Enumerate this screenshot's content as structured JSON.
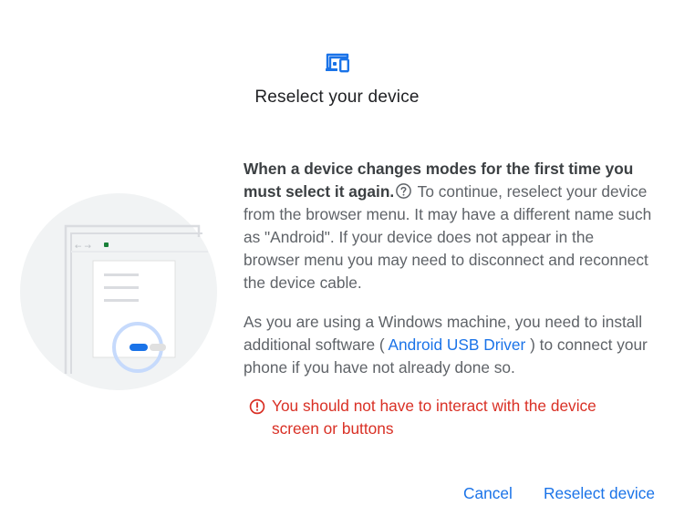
{
  "dialog": {
    "title": "Reselect your device",
    "header_icon": "devices-icon",
    "paragraph1": {
      "bold": "When a device changes modes for the first time you must select it again.",
      "help_icon": "help-circle-icon",
      "rest": " To continue, reselect your device from the browser menu. It may have a different name such as \"Android\". If your device does not appear in the browser menu you may need to disconnect and reconnect the device cable."
    },
    "paragraph2": {
      "before": "As you are using a Windows machine, you need to install additional software ( ",
      "link": "Android USB Driver",
      "after": " ) to connect your phone if you have not already done so."
    },
    "warning": {
      "icon": "error-circle-icon",
      "text": "You should not have to interact with the device screen or buttons"
    },
    "buttons": {
      "cancel": "Cancel",
      "reselect": "Reselect device"
    },
    "colors": {
      "accent": "#1a73e8",
      "error": "#d93025",
      "text": "#5f6368",
      "title": "#202124"
    }
  }
}
